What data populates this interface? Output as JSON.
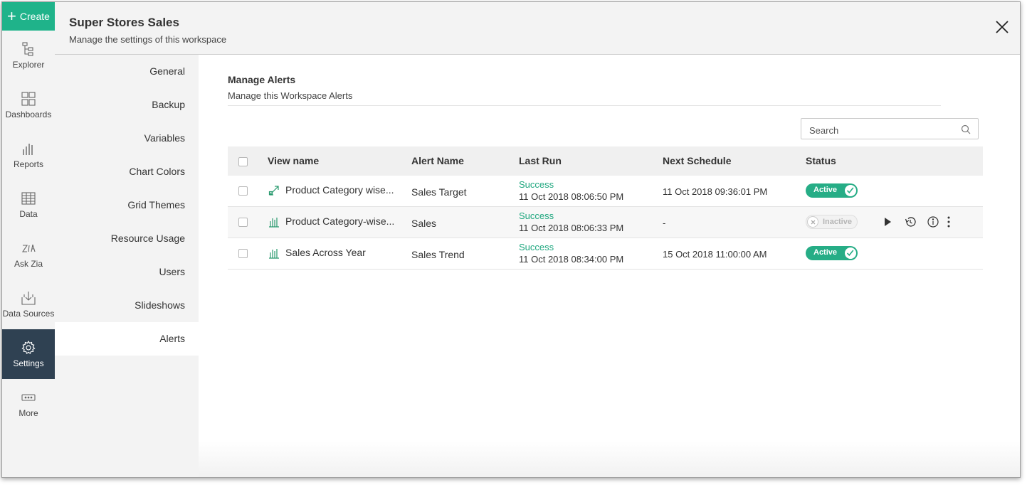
{
  "rail": {
    "create_label": "Create",
    "items": [
      {
        "label": "Explorer",
        "icon": "explorer-icon"
      },
      {
        "label": "Dashboards",
        "icon": "dashboards-icon"
      },
      {
        "label": "Reports",
        "icon": "reports-icon"
      },
      {
        "label": "Data",
        "icon": "data-icon"
      },
      {
        "label": "Ask Zia",
        "icon": "ask-zia-icon"
      },
      {
        "label": "Data Sources",
        "icon": "data-sources-icon"
      },
      {
        "label": "Settings",
        "icon": "settings-icon"
      },
      {
        "label": "More",
        "icon": "more-icon"
      }
    ],
    "active": "Settings"
  },
  "header": {
    "title": "Super Stores Sales",
    "subtitle": "Manage the settings of this workspace"
  },
  "settings_nav": {
    "items": [
      "General",
      "Backup",
      "Variables",
      "Chart Colors",
      "Grid Themes",
      "Resource Usage",
      "Users",
      "Slideshows",
      "Alerts"
    ],
    "active": "Alerts"
  },
  "main": {
    "title": "Manage Alerts",
    "subtitle": "Manage this Workspace Alerts",
    "search_placeholder": "Search",
    "columns": [
      "View name",
      "Alert Name",
      "Last Run",
      "Next Schedule",
      "Status"
    ],
    "rows": [
      {
        "view_icon": "pivot-icon",
        "view_name": "Product Category wise...",
        "alert_name": "Sales Target",
        "last_run_status": "Success",
        "last_run_time": "11 Oct 2018 08:06:50 PM",
        "next_schedule": "11 Oct 2018 09:36:01 PM",
        "status": "Active"
      },
      {
        "view_icon": "bar-chart-icon",
        "view_name": "Product Category-wise...",
        "alert_name": "Sales",
        "last_run_status": "Success",
        "last_run_time": "11 Oct 2018 08:06:33 PM",
        "next_schedule": "-",
        "status": "Inactive"
      },
      {
        "view_icon": "bar-chart-icon",
        "view_name": "Sales Across Year",
        "alert_name": "Sales Trend",
        "last_run_status": "Success",
        "last_run_time": "11 Oct 2018 08:34:00 PM",
        "next_schedule": "15 Oct 2018 11:00:00 AM",
        "status": "Active"
      }
    ]
  },
  "colors": {
    "accent": "#1fb38a",
    "active_rail": "#2f4152",
    "success": "#1fa77f"
  }
}
